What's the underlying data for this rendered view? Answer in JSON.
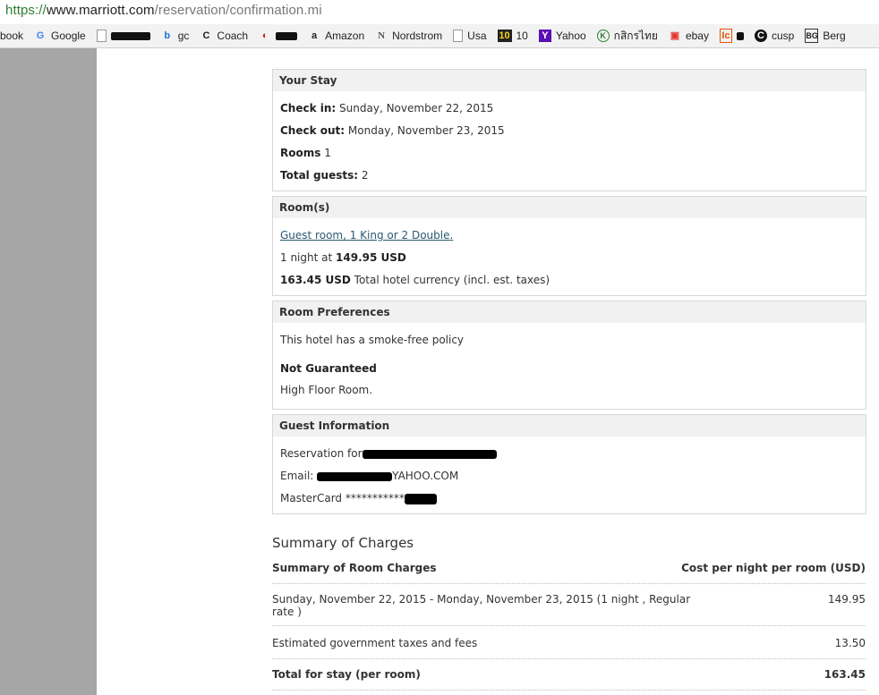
{
  "browser": {
    "url_protocol": "https://",
    "url_host": "www.marriott.com",
    "url_path": "/reservation/confirmation.mi",
    "bookmarks": [
      {
        "label": "book",
        "icon": "none"
      },
      {
        "label": "Google",
        "icon": "google-icon"
      },
      {
        "label": "",
        "icon": "page-icon",
        "redacted": true
      },
      {
        "label": "gc",
        "icon": "b-logo-icon"
      },
      {
        "label": "Coach",
        "icon": "coach-icon"
      },
      {
        "label": "",
        "icon": "red-logo-icon",
        "redacted": true
      },
      {
        "label": "Amazon",
        "icon": "amazon-icon"
      },
      {
        "label": "Nordstrom",
        "icon": "nordstrom-icon"
      },
      {
        "label": "Usa",
        "icon": "page-icon"
      },
      {
        "label": "10",
        "icon": "ten-icon"
      },
      {
        "label": "Yahoo",
        "icon": "yahoo-icon"
      },
      {
        "label": "กสิกรไทย",
        "icon": "kbank-icon"
      },
      {
        "label": "ebay",
        "icon": "ebay-icon"
      },
      {
        "label": "",
        "icon": "ic-icon",
        "redacted": true
      },
      {
        "label": "cusp",
        "icon": "cusp-icon"
      },
      {
        "label": "Berg",
        "icon": "berg-icon"
      }
    ]
  },
  "your_stay": {
    "title": "Your Stay",
    "checkin_label": "Check in:",
    "checkin_value": "Sunday, November 22, 2015",
    "checkout_label": "Check out:",
    "checkout_value": "Monday, November 23, 2015",
    "rooms_label": "Rooms",
    "rooms_value": "1",
    "guests_label": "Total guests:",
    "guests_value": "2"
  },
  "rooms": {
    "title": "Room(s)",
    "room_link": "Guest room, 1 King or 2 Double.",
    "night_prefix": "1 night at",
    "night_rate": "149.95 USD",
    "total_amount": "163.45 USD",
    "total_suffix": "Total hotel currency (incl. est. taxes)"
  },
  "preferences": {
    "title": "Room Preferences",
    "smoke_policy": "This hotel has a smoke-free policy",
    "not_guaranteed": "Not Guaranteed",
    "floor_pref": "High Floor Room."
  },
  "guest": {
    "title": "Guest Information",
    "reservation_label": "Reservation for",
    "email_label": "Email:",
    "email_suffix": "YAHOO.COM",
    "card_label": "MasterCard ***********"
  },
  "summary": {
    "title": "Summary of Charges",
    "header_left": "Summary of Room Charges",
    "header_right": "Cost per night per room (USD)",
    "rows": [
      {
        "label_line1": "Sunday, November 22, 2015 - Monday, November 23, 2015 (1 night , Regular",
        "label_line2": "rate )",
        "value": "149.95"
      },
      {
        "label_line1": "Estimated government taxes and fees",
        "label_line2": "",
        "value": "13.50"
      },
      {
        "label_line1": "Total for stay (per room)",
        "label_line2": "",
        "value": "163.45"
      }
    ]
  }
}
